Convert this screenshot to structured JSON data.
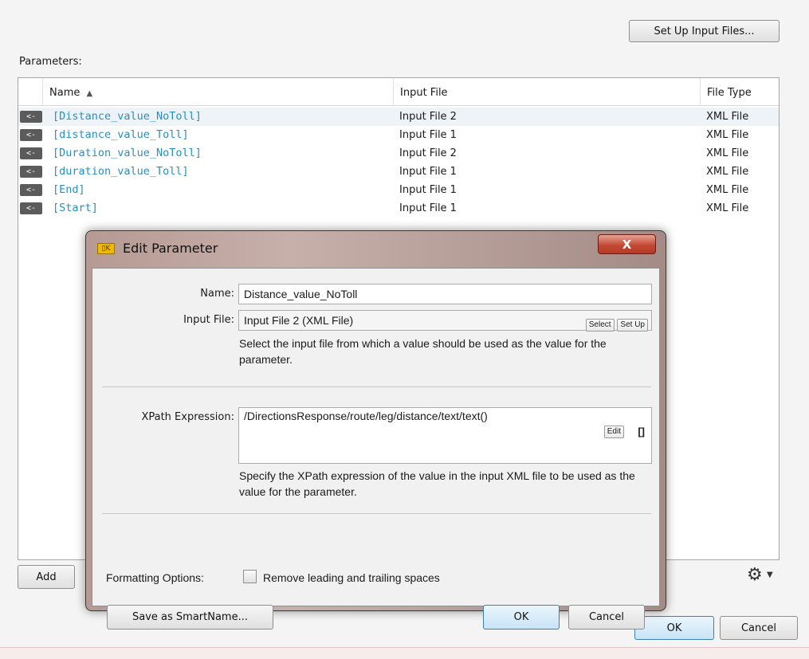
{
  "toolbar": {
    "setup_input_files_label": "Set Up Input Files..."
  },
  "parameters_label": "Parameters:",
  "table": {
    "columns": [
      "Name",
      "Input File",
      "File Type"
    ],
    "rows": [
      {
        "arrow": "<-",
        "name": "[Distance_value_NoToll]",
        "input_file": "Input File 2",
        "file_type": "XML File"
      },
      {
        "arrow": "<-",
        "name": "[distance_value_Toll]",
        "input_file": "Input File 1",
        "file_type": "XML File"
      },
      {
        "arrow": "<-",
        "name": "[Duration_value_NoToll]",
        "input_file": "Input File 2",
        "file_type": "XML File"
      },
      {
        "arrow": "<-",
        "name": "[duration_value_Toll]",
        "input_file": "Input File 1",
        "file_type": "XML File"
      },
      {
        "arrow": "<-",
        "name": "[End]",
        "input_file": "Input File 1",
        "file_type": "XML File"
      },
      {
        "arrow": "<-",
        "name": "[Start]",
        "input_file": "Input File 1",
        "file_type": "XML File"
      }
    ]
  },
  "add_label": "Add",
  "footer": {
    "ok_label": "OK",
    "cancel_label": "Cancel"
  },
  "dialog": {
    "title": "Edit Parameter",
    "close_label": "X",
    "name_label": "Name:",
    "name_value": "Distance_value_NoToll",
    "input_file_label": "Input File:",
    "input_file_value": "Input File 2 (XML File)",
    "select_label": "Select",
    "setup_label": "Set Up",
    "input_help": "Select the input file from which a value should be used as the value for the parameter.",
    "xpath_label": "XPath Expression:",
    "xpath_value": "/DirectionsResponse/route/leg/distance/text/text()",
    "edit_label": "Edit",
    "brackets_label": "[]",
    "xpath_help": "Specify the XPath expression of the value in the input XML file to be used as the value for the parameter.",
    "formatting_label": "Formatting Options:",
    "remove_spaces_label": "Remove leading and trailing spaces",
    "smartname_label": "Save as SmartName...",
    "ok_label": "OK",
    "cancel_label": "Cancel"
  }
}
